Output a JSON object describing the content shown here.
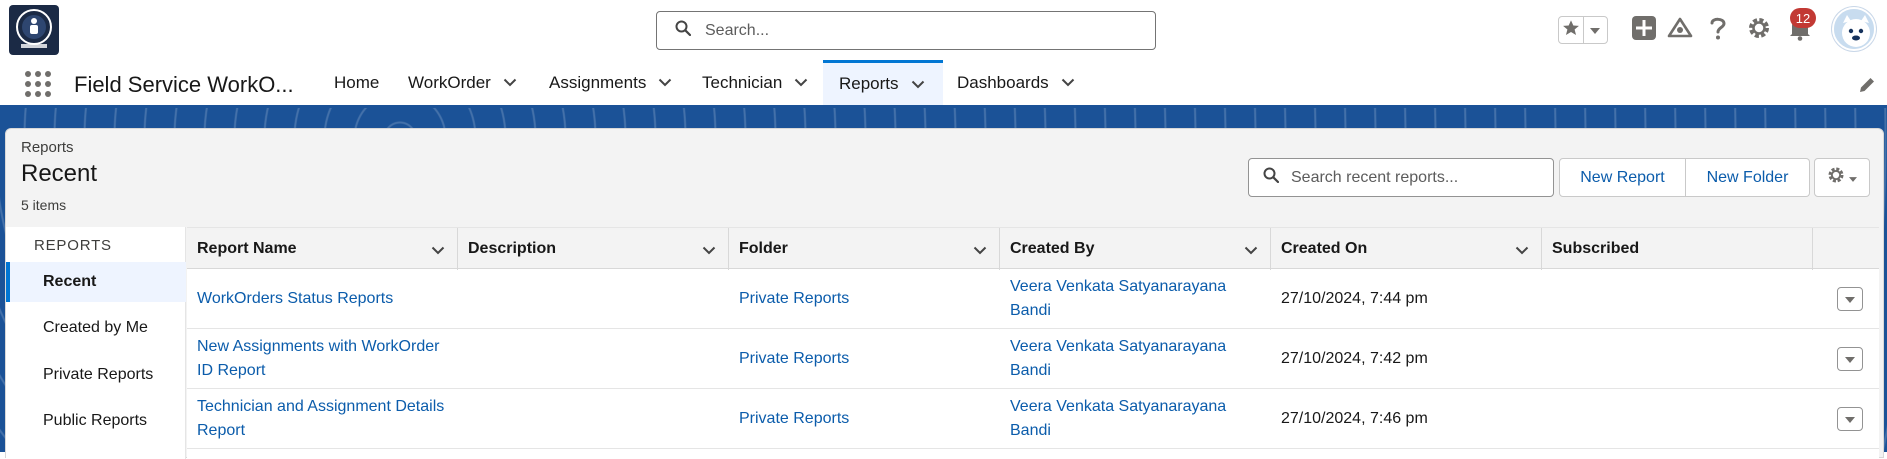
{
  "header": {
    "search_placeholder": "Search...",
    "notification_count": "12"
  },
  "app": {
    "name": "Field Service WorkO..."
  },
  "nav": {
    "items": [
      {
        "label": "Home"
      },
      {
        "label": "WorkOrder"
      },
      {
        "label": "Assignments"
      },
      {
        "label": "Technician"
      },
      {
        "label": "Reports"
      },
      {
        "label": "Dashboards"
      }
    ],
    "active": "Reports"
  },
  "list_view": {
    "breadcrumb": "Reports",
    "title": "Recent",
    "count": "5 items",
    "search_placeholder": "Search recent reports...",
    "new_report_label": "New Report",
    "new_folder_label": "New Folder"
  },
  "sidebar": {
    "heading": "REPORTS",
    "items": [
      {
        "label": "Recent"
      },
      {
        "label": "Created by Me"
      },
      {
        "label": "Private Reports"
      },
      {
        "label": "Public Reports"
      }
    ],
    "active": "Recent"
  },
  "table": {
    "columns": [
      "Report Name",
      "Description",
      "Folder",
      "Created By",
      "Created On",
      "Subscribed"
    ],
    "rows": [
      {
        "name": "WorkOrders Status Reports",
        "description": "",
        "folder": "Private Reports",
        "created_by": "Veera Venkata Satyanarayana Bandi",
        "created_on": "27/10/2024, 7:44 pm",
        "subscribed": ""
      },
      {
        "name": "New Assignments with WorkOrder ID Report",
        "description": "",
        "folder": "Private Reports",
        "created_by": "Veera Venkata Satyanarayana Bandi",
        "created_on": "27/10/2024, 7:42 pm",
        "subscribed": ""
      },
      {
        "name": "Technician and Assignment Details Report",
        "description": "",
        "folder": "Private Reports",
        "created_by": "Veera Venkata Satyanarayana Bandi",
        "created_on": "27/10/2024, 7:46 pm",
        "subscribed": ""
      }
    ]
  },
  "colors": {
    "brand_blue": "#1b5297",
    "link_blue": "#0b5cab",
    "accent": "#0176d3",
    "badge_red": "#c23934"
  }
}
